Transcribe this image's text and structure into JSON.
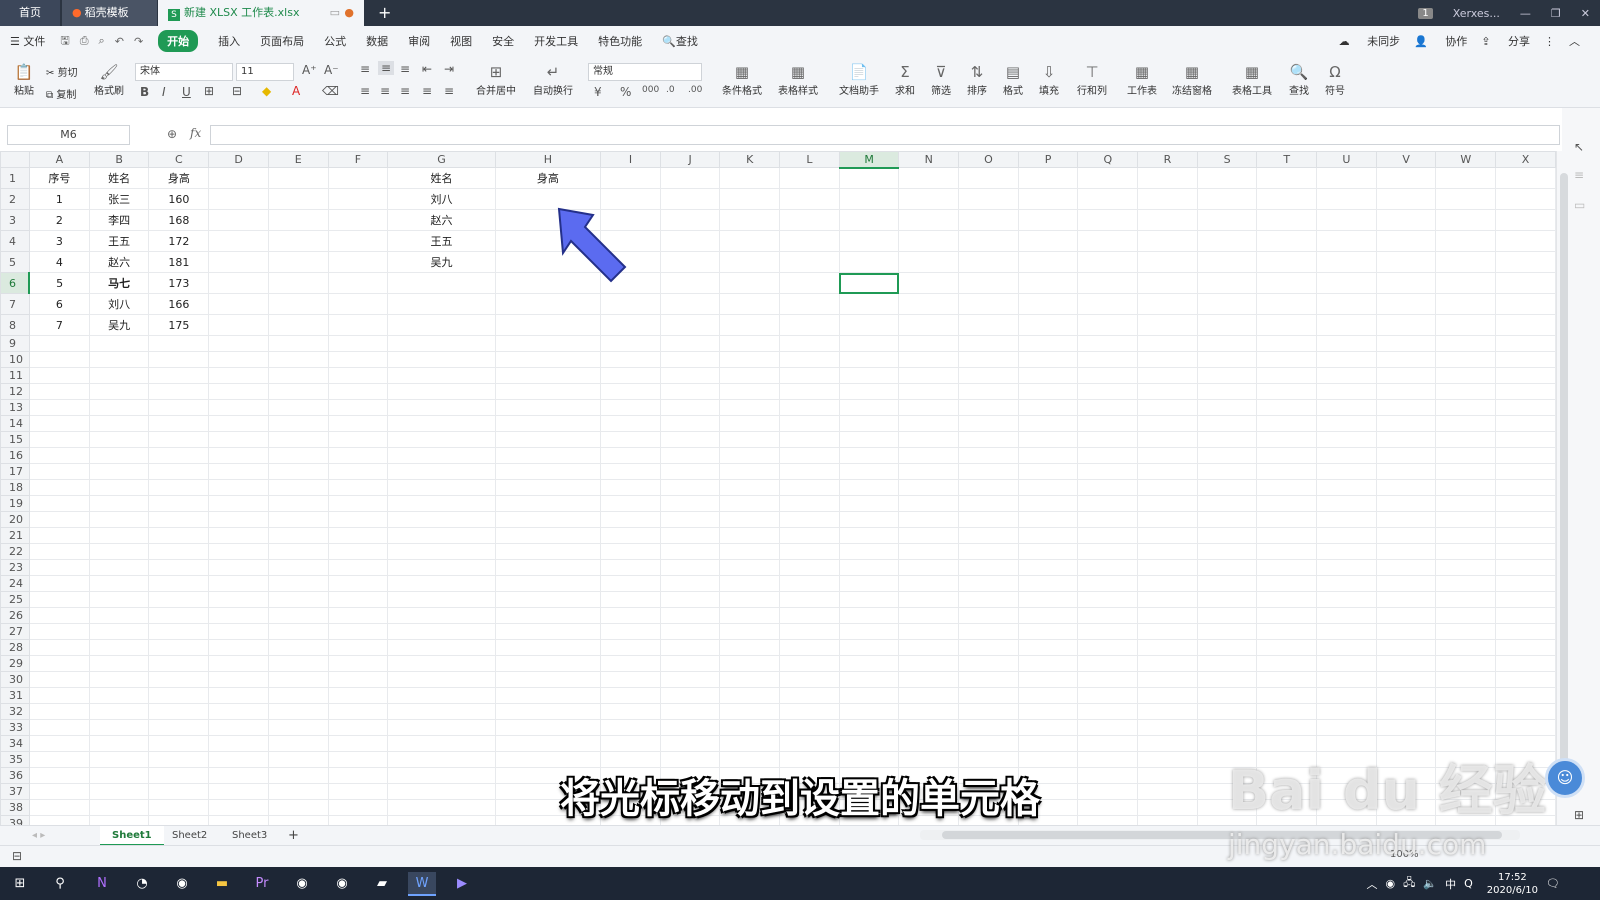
{
  "tabs": {
    "home": "首页",
    "t1": "稻壳模板",
    "t2": "新建 XLSX 工作表.xlsx",
    "user": "Xerxes..."
  },
  "menu": {
    "file": "文件",
    "items": [
      "开始",
      "插入",
      "页面布局",
      "公式",
      "数据",
      "审阅",
      "视图",
      "安全",
      "开发工具",
      "特色功能"
    ],
    "search": "查找",
    "sync": "未同步",
    "collab": "协作",
    "share": "分享"
  },
  "ribbon": {
    "paste": "粘贴",
    "cut": "剪切",
    "copy": "复制",
    "format_painter": "格式刷",
    "font": "宋体",
    "size": "11",
    "merge": "合并居中",
    "wrap": "自动换行",
    "numfmt": "常规",
    "cond": "条件格式",
    "tblstyle": "表格样式",
    "doc_helper": "文档助手",
    "sum": "求和",
    "filter": "筛选",
    "sort": "排序",
    "format": "格式",
    "fill": "填充",
    "rowcol": "行和列",
    "sheet": "工作表",
    "freeze": "冻结窗格",
    "tbltool": "表格工具",
    "find": "查找",
    "symbol": "符号"
  },
  "formula": {
    "cellref": "M6",
    "fx": "fx"
  },
  "grid": {
    "columns": [
      "A",
      "B",
      "C",
      "D",
      "E",
      "F",
      "G",
      "H",
      "I",
      "J",
      "K",
      "L",
      "M",
      "N",
      "O",
      "P",
      "Q",
      "R",
      "S",
      "T",
      "U",
      "V",
      "W",
      "X"
    ],
    "selected_col": "M",
    "selected_row": 6,
    "rows": [
      {
        "n": 1,
        "A": "序号",
        "B": "姓名",
        "C": "身高",
        "G": "姓名",
        "H": "身高"
      },
      {
        "n": 2,
        "A": "1",
        "B": "张三",
        "C": "160",
        "G": "刘八"
      },
      {
        "n": 3,
        "A": "2",
        "B": "李四",
        "C": "168",
        "G": "赵六"
      },
      {
        "n": 4,
        "A": "3",
        "B": "王五",
        "C": "172",
        "G": "王五"
      },
      {
        "n": 5,
        "A": "4",
        "B": "赵六",
        "C": "181",
        "G": "吴九"
      },
      {
        "n": 6,
        "A": "5",
        "B": "马七",
        "C": "173"
      },
      {
        "n": 7,
        "A": "6",
        "B": "刘八",
        "C": "166"
      },
      {
        "n": 8,
        "A": "7",
        "B": "吴九",
        "C": "175"
      }
    ],
    "total_rows": 40
  },
  "sheets": [
    "Sheet1",
    "Sheet2",
    "Sheet3"
  ],
  "status": {
    "zoom": "100%"
  },
  "taskbar": {
    "time": "17:52",
    "date": "2020/6/10",
    "ime": "中"
  },
  "caption": "将光标移动到设置的单元格",
  "watermark": {
    "brand": "Bai du 经验",
    "url": "jingyan.baidu.com"
  }
}
